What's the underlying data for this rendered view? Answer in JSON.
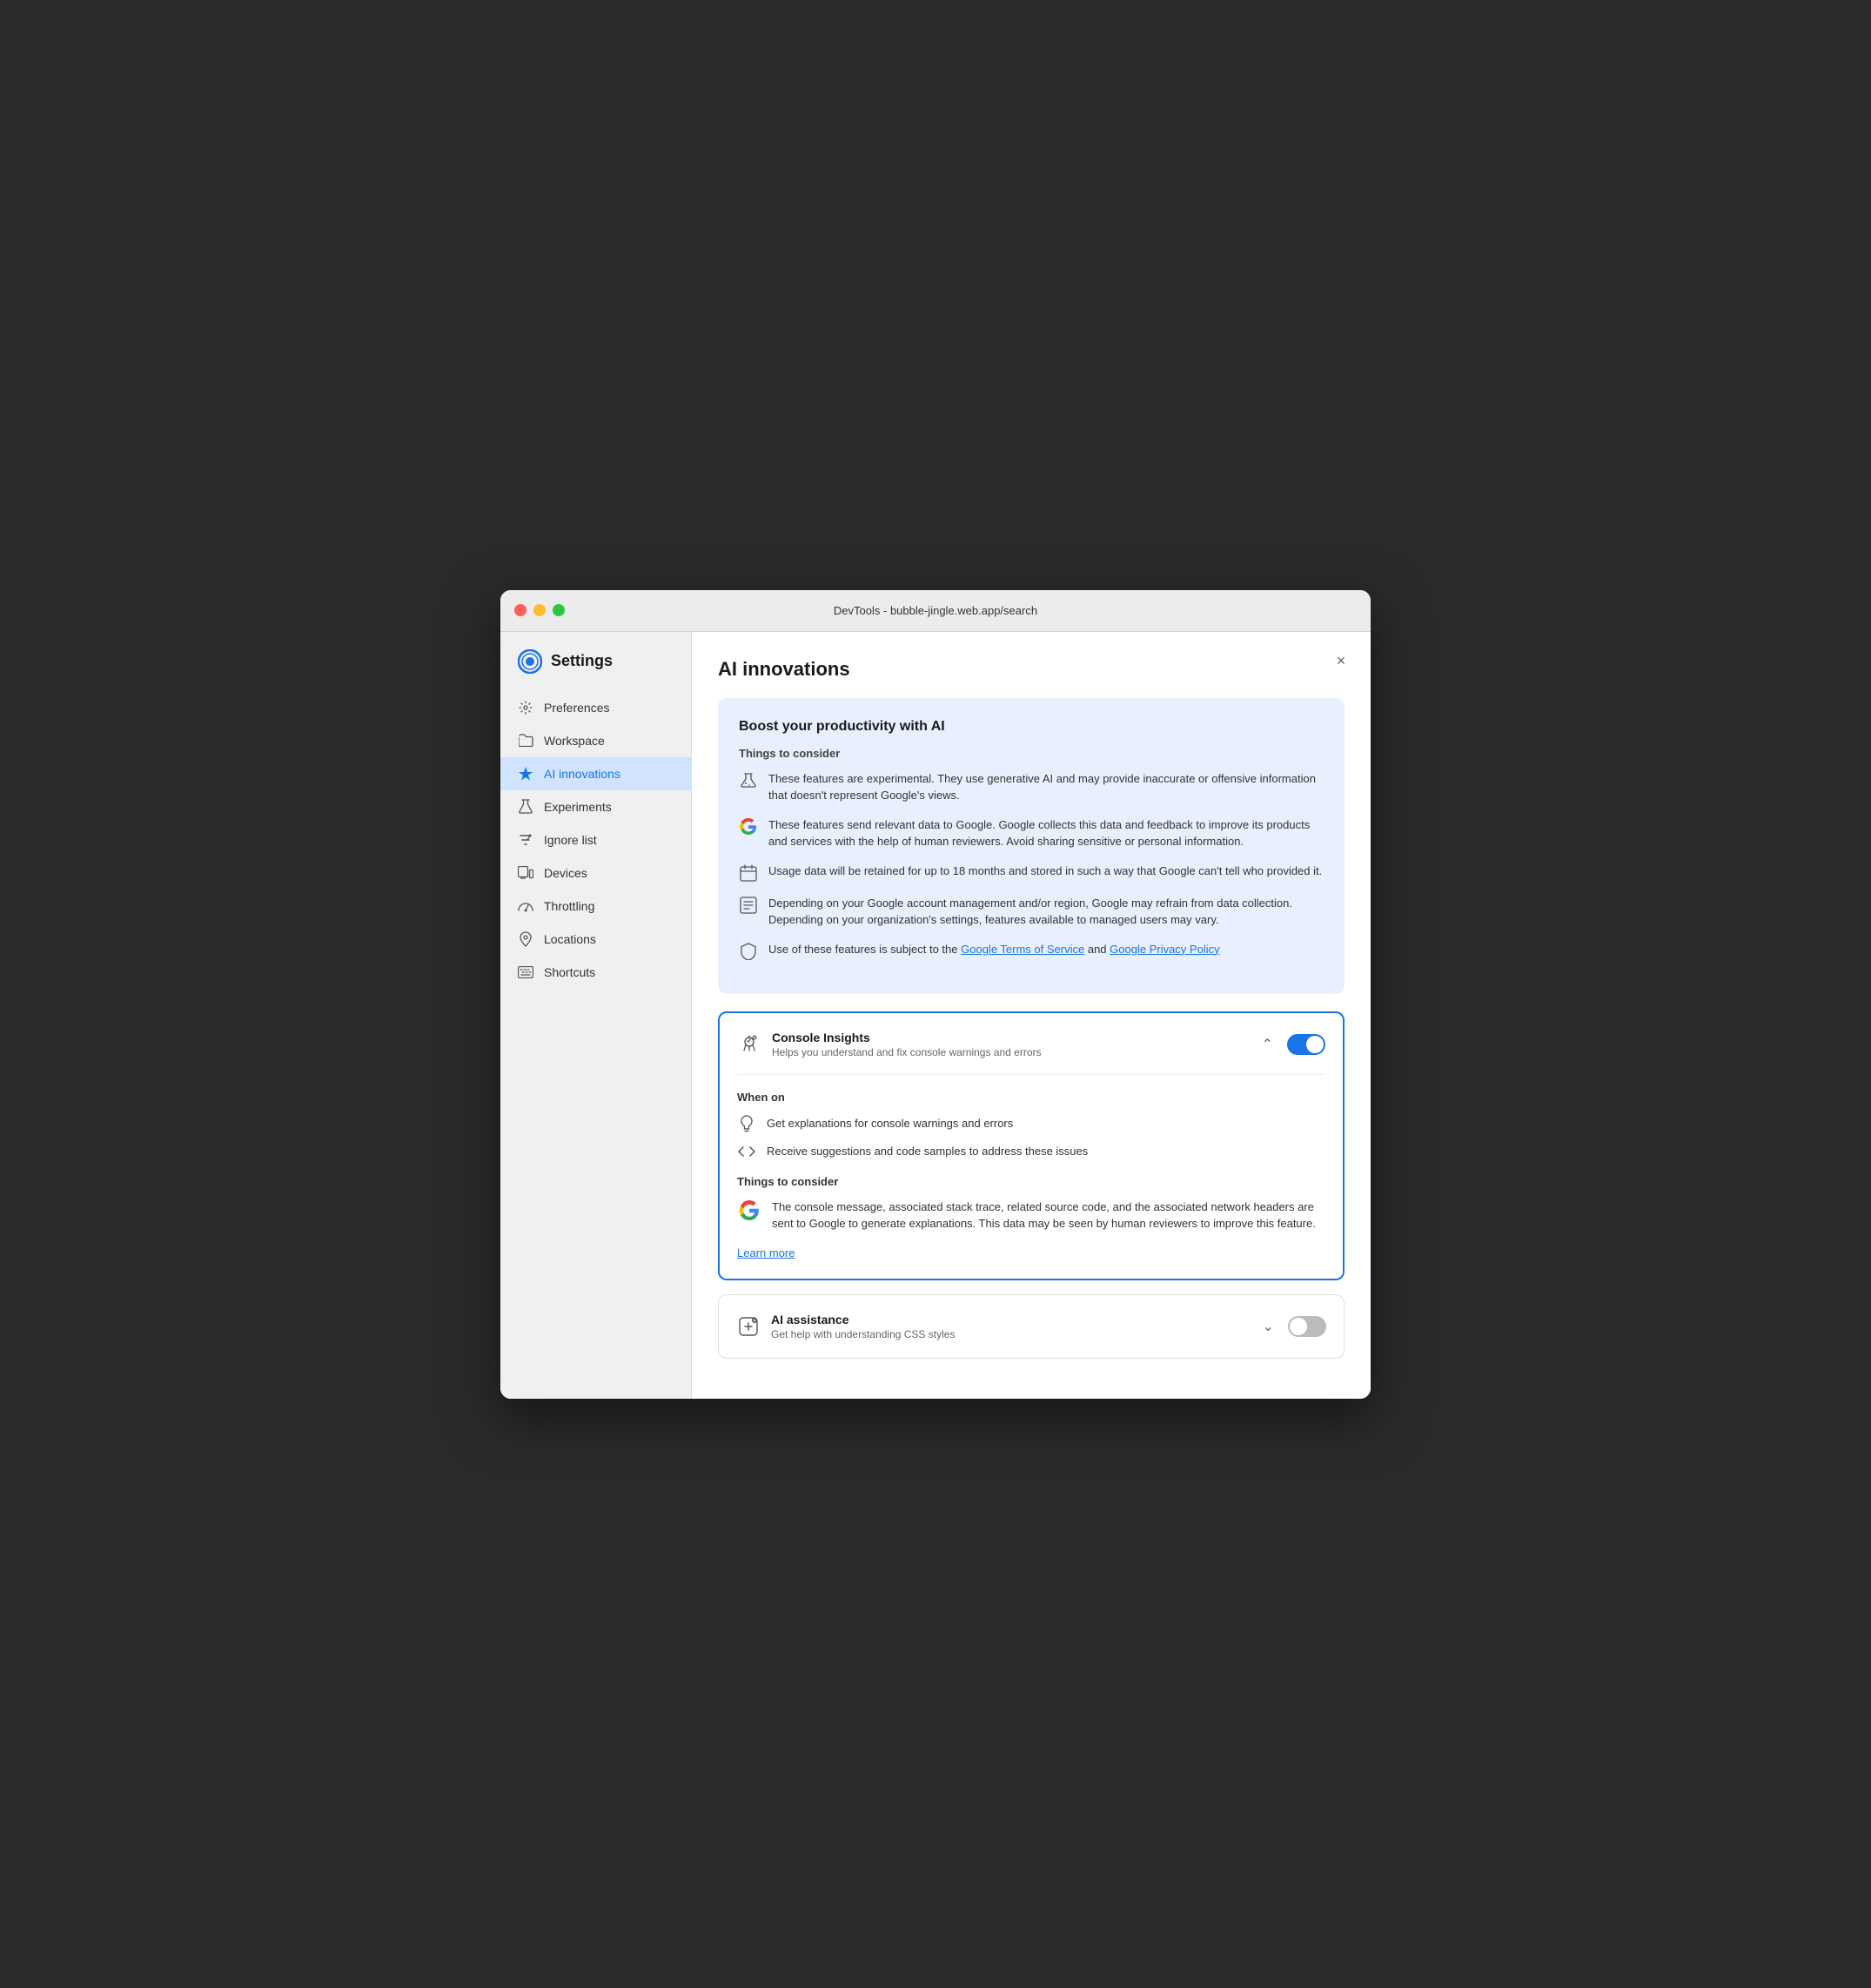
{
  "titlebar": {
    "title": "DevTools - bubble-jingle.web.app/search"
  },
  "sidebar": {
    "title": "Settings",
    "items": [
      {
        "id": "preferences",
        "label": "Preferences",
        "icon": "gear"
      },
      {
        "id": "workspace",
        "label": "Workspace",
        "icon": "folder"
      },
      {
        "id": "ai-innovations",
        "label": "AI innovations",
        "icon": "sparkle",
        "active": true
      },
      {
        "id": "experiments",
        "label": "Experiments",
        "icon": "flask"
      },
      {
        "id": "ignore-list",
        "label": "Ignore list",
        "icon": "filter"
      },
      {
        "id": "devices",
        "label": "Devices",
        "icon": "devices"
      },
      {
        "id": "throttling",
        "label": "Throttling",
        "icon": "gauge"
      },
      {
        "id": "locations",
        "label": "Locations",
        "icon": "pin"
      },
      {
        "id": "shortcuts",
        "label": "Shortcuts",
        "icon": "keyboard"
      }
    ]
  },
  "main": {
    "page_title": "AI innovations",
    "info_card": {
      "title": "Boost your productivity with AI",
      "subtitle": "Things to consider",
      "items": [
        {
          "icon": "experiment",
          "text": "These features are experimental. They use generative AI and may provide inaccurate or offensive information that doesn't represent Google's views."
        },
        {
          "icon": "google",
          "text": "These features send relevant data to Google. Google collects this data and feedback to improve its products and services with the help of human reviewers. Avoid sharing sensitive or personal information."
        },
        {
          "icon": "calendar",
          "text": "Usage data will be retained for up to 18 months and stored in such a way that Google can't tell who provided it."
        },
        {
          "icon": "list",
          "text": "Depending on your Google account management and/or region, Google may refrain from data collection. Depending on your organization's settings, features available to managed users may vary."
        },
        {
          "icon": "shield",
          "text_before": "Use of these features is subject to the ",
          "link1_text": "Google Terms of Service",
          "link1_href": "#",
          "text_middle": " and ",
          "link2_text": "Google Privacy Policy",
          "link2_href": "#",
          "text_after": "",
          "has_links": true
        }
      ]
    },
    "console_insights": {
      "name": "Console Insights",
      "description": "Helps you understand and fix console warnings and errors",
      "enabled": true,
      "when_on_label": "When on",
      "when_on_items": [
        {
          "icon": "lightbulb",
          "text": "Get explanations for console warnings and errors"
        },
        {
          "icon": "code",
          "text": "Receive suggestions and code samples to address these issues"
        }
      ],
      "things_label": "Things to consider",
      "things_items": [
        {
          "icon": "google",
          "text": "The console message, associated stack trace, related source code, and the associated network headers are sent to Google to generate explanations. This data may be seen by human reviewers to improve this feature."
        }
      ],
      "learn_more_label": "Learn more"
    },
    "ai_assistance": {
      "name": "AI assistance",
      "description": "Get help with understanding CSS styles",
      "enabled": false
    }
  },
  "close_button_label": "×"
}
